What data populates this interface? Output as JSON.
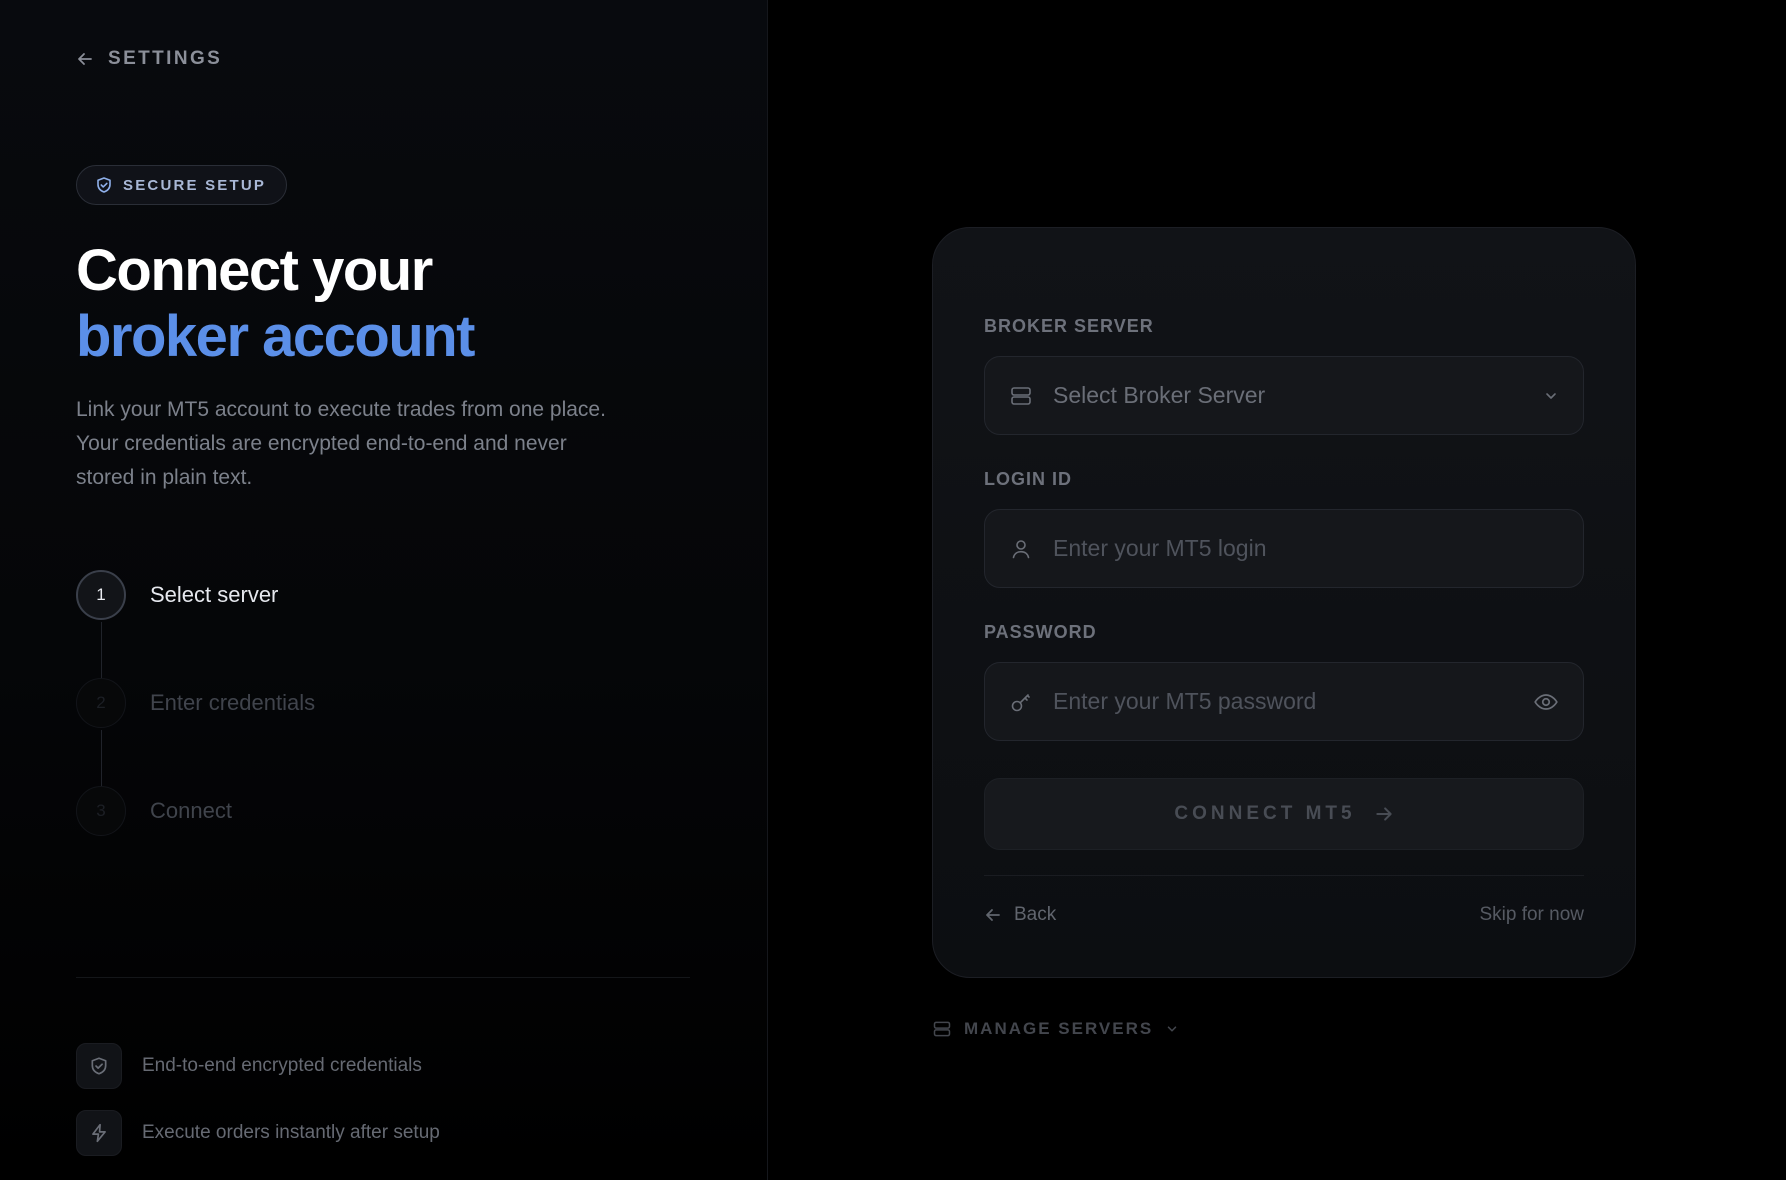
{
  "nav": {
    "back_label": "SETTINGS"
  },
  "badge": {
    "label": "SECURE SETUP"
  },
  "hero": {
    "title_line1": "Connect your",
    "title_line2": "broker account",
    "description": "Link your MT5 account to execute trades from one place. Your credentials are encrypted end-to-end and never stored in plain text."
  },
  "steps": [
    {
      "number": "1",
      "label": "Select server",
      "state": "active"
    },
    {
      "number": "2",
      "label": "Enter credentials",
      "state": "inactive"
    },
    {
      "number": "3",
      "label": "Connect",
      "state": "inactive"
    }
  ],
  "features": [
    {
      "icon": "shield-icon",
      "text": "End-to-end encrypted credentials"
    },
    {
      "icon": "bolt-icon",
      "text": "Execute orders instantly after setup"
    }
  ],
  "form": {
    "broker_label": "BROKER SERVER",
    "broker_placeholder": "Select Broker Server",
    "login_label": "LOGIN ID",
    "login_placeholder": "Enter your MT5 login",
    "password_label": "PASSWORD",
    "password_placeholder": "Enter your MT5 password",
    "connect_label": "CONNECT MT5",
    "back_label": "Back",
    "skip_label": "Skip for now"
  },
  "manage": {
    "label": "MANAGE SERVERS"
  },
  "colors": {
    "accent": "#5b8fe8",
    "background": "#000000",
    "card": "#111317"
  }
}
